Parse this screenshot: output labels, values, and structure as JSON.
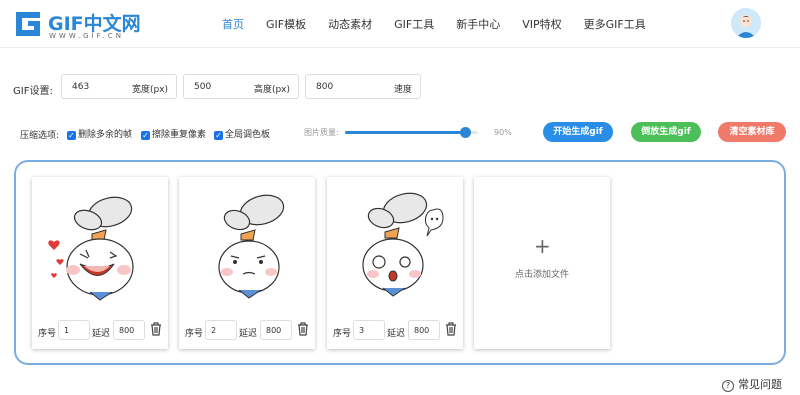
{
  "header": {
    "logo_title": "GIF中文网",
    "logo_sub": "WWW.GIF.CN",
    "nav": [
      {
        "label": "首页",
        "active": true
      },
      {
        "label": "GIF模板",
        "active": false
      },
      {
        "label": "动态素材",
        "active": false
      },
      {
        "label": "GIF工具",
        "active": false
      },
      {
        "label": "新手中心",
        "active": false
      },
      {
        "label": "VIP特权",
        "active": false
      },
      {
        "label": "更多GIF工具",
        "active": false
      }
    ]
  },
  "settings": {
    "label": "GIF设置:",
    "width_value": "463",
    "width_unit": "宽度(px)",
    "height_value": "500",
    "height_unit": "高度(px)",
    "speed_value": "800",
    "speed_unit": "速度"
  },
  "compress": {
    "label": "压缩选项:",
    "opt1": "删除多余的帧",
    "opt2": "擦除重复像素",
    "opt3": "全局调色板",
    "quality_label": "图片质量:",
    "quality_value": "90%",
    "quality_fraction": 0.9
  },
  "buttons": {
    "start": "开始生成gif",
    "reverse": "倒放生成gif",
    "clear": "清空素材库"
  },
  "colors": {
    "start": "#2a8de8",
    "reverse": "#4dbf59",
    "clear": "#ef7a6a",
    "accent": "#2a86d6"
  },
  "frames": [
    {
      "seq_label": "序号",
      "seq": "1",
      "delay_label": "延迟",
      "delay": "800"
    },
    {
      "seq_label": "序号",
      "seq": "2",
      "delay_label": "延迟",
      "delay": "800"
    },
    {
      "seq_label": "序号",
      "seq": "3",
      "delay_label": "延迟",
      "delay": "800"
    }
  ],
  "add_file": {
    "plus": "+",
    "label": "点击添加文件"
  },
  "faq": "常见问题"
}
